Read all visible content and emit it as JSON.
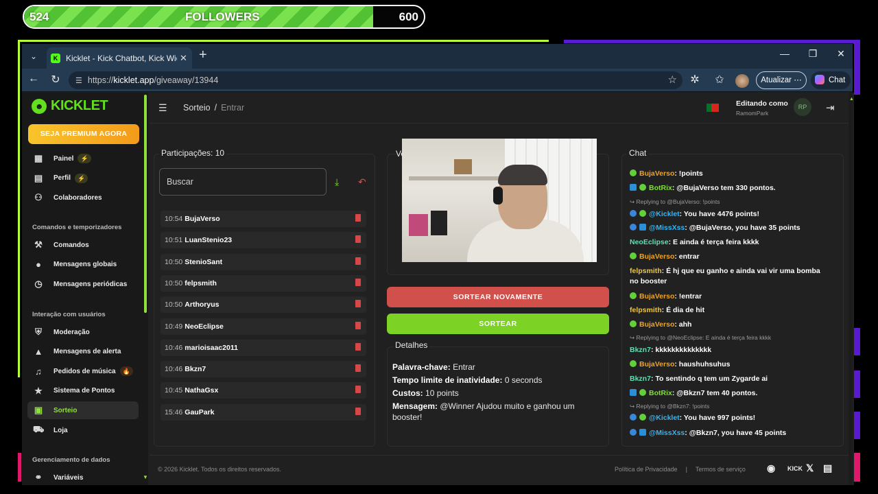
{
  "followers": {
    "current": "524",
    "label": "FOLLOWERS",
    "goal": "600",
    "progress": 0.873
  },
  "browser": {
    "tab_title": "Kicklet - Kick Chatbot, Kick Widgets",
    "url_prefix": "https://",
    "url_host": "kicklet.app",
    "url_path": "/giveaway/13944",
    "update_label": "Atualizar",
    "chat_label": "Chat"
  },
  "sidebar": {
    "logo": "KICKLET",
    "premium": "SEJA PREMIUM AGORA",
    "items_top": [
      {
        "label": "Painel",
        "icon": "dashboard-icon",
        "badge": "⚡"
      },
      {
        "label": "Perfil",
        "icon": "profile-icon",
        "badge": "⚡"
      },
      {
        "label": "Colaboradores",
        "icon": "collaborators-icon"
      }
    ],
    "section_commands": "Comandos e temporizadores",
    "items_commands": [
      {
        "label": "Comandos",
        "icon": "hammer-icon"
      },
      {
        "label": "Mensagens globais",
        "icon": "chat-bubble-icon"
      },
      {
        "label": "Mensagens periódicas",
        "icon": "clock-icon"
      }
    ],
    "section_interaction": "Interação com usuários",
    "items_interaction": [
      {
        "label": "Moderação",
        "icon": "shield-icon"
      },
      {
        "label": "Mensagens de alerta",
        "icon": "alert-icon"
      },
      {
        "label": "Pedidos de música",
        "icon": "music-icon",
        "badge": "🔥"
      },
      {
        "label": "Sistema de Pontos",
        "icon": "star-icon"
      },
      {
        "label": "Sorteio",
        "icon": "gift-icon",
        "active": true
      },
      {
        "label": "Loja",
        "icon": "cart-icon"
      }
    ],
    "section_data": "Gerenciamento de dados",
    "items_data": [
      {
        "label": "Variáveis",
        "icon": "link-icon"
      }
    ]
  },
  "header": {
    "crumb_1": "Sorteio",
    "crumb_sep": "/",
    "crumb_2": "Entrar",
    "editing_label": "Editando como",
    "editing_user": "RamomPark"
  },
  "participants": {
    "title": "Participações: 10",
    "search_placeholder": "Buscar",
    "rows": [
      {
        "time": "10:54",
        "name": "BujaVerso"
      },
      {
        "time": "10:51",
        "name": "LuanStenio23"
      },
      {
        "time": "10:50",
        "name": "StenioSant"
      },
      {
        "time": "10:50",
        "name": "felpsmith"
      },
      {
        "time": "10:50",
        "name": "Arthoryus"
      },
      {
        "time": "10:49",
        "name": "NeoEclipse"
      },
      {
        "time": "10:46",
        "name": "marioisaac2011"
      },
      {
        "time": "10:46",
        "name": "Bkzn7"
      },
      {
        "time": "10:45",
        "name": "NathaGsx"
      },
      {
        "time": "15:46",
        "name": "GauPark"
      }
    ]
  },
  "center": {
    "winner_title_partial": "Ve",
    "btn_again": "SORTEAR NOVAMENTE",
    "btn_draw": "SORTEAR",
    "details_title": "Detalhes",
    "keyword_label": "Palavra-chave:",
    "keyword_value": "Entrar",
    "timeout_label": "Tempo limite de inatividade:",
    "timeout_value": "0 seconds",
    "cost_label": "Custos:",
    "cost_value": "10 points",
    "message_label": "Mensagem:",
    "message_value": "@Winner Ajudou muito e ganhou um booster!"
  },
  "chat": {
    "title": "Chat",
    "lines": [
      {
        "user": "BujaVerso",
        "text": "!points"
      },
      {
        "user": "BotRix",
        "text": "@BujaVerso tem 330 pontos."
      },
      {
        "reply": "Replying to @BujaVerso: !points"
      },
      {
        "user": "@Kicklet",
        "text": "You have 4476 points!"
      },
      {
        "user": "@MissXss",
        "text": "@BujaVerso, you have 35 points"
      },
      {
        "user": "NeoEclipse",
        "text": "E ainda é terça feira kkkk"
      },
      {
        "user": "BujaVerso",
        "text": "entrar"
      },
      {
        "user": "felpsmith",
        "text": "É hj que eu ganho e ainda vai vir uma bomba"
      },
      {
        "cont": "no booster"
      },
      {
        "user": "BujaVerso",
        "text": "!entrar"
      },
      {
        "user": "felpsmith",
        "text": "É dia de hit"
      },
      {
        "user": "BujaVerso",
        "text": "ahh"
      },
      {
        "reply": "Replying to @NeoEclipse: E ainda é terça feira kkkk"
      },
      {
        "user": "Bkzn7",
        "text": "kkkkkkkkkkkkkk"
      },
      {
        "user": "BujaVerso",
        "text": "haushuhsuhus"
      },
      {
        "user": "Bkzn7",
        "text": "To sentindo q tem um Zygarde ai"
      },
      {
        "user": "BotRix",
        "text": "@Bkzn7 tem 40 pontos."
      },
      {
        "reply": "Replying to @Bkzn7: !points"
      },
      {
        "user": "@Kicklet",
        "text": "You have 997 points!"
      },
      {
        "user": "@MissXss",
        "text": "@Bkzn7, you have 45 points"
      }
    ]
  },
  "footer": {
    "copyright": "© 2026 Kicklet. Todos os direitos reservados.",
    "privacy": "Política de Privacidade",
    "sep": "|",
    "terms": "Termos de serviço",
    "kick_label": "KICK"
  },
  "colors": {
    "accent": "#8ee03c",
    "danger": "#d2504b",
    "premium": "#f8c42b"
  }
}
